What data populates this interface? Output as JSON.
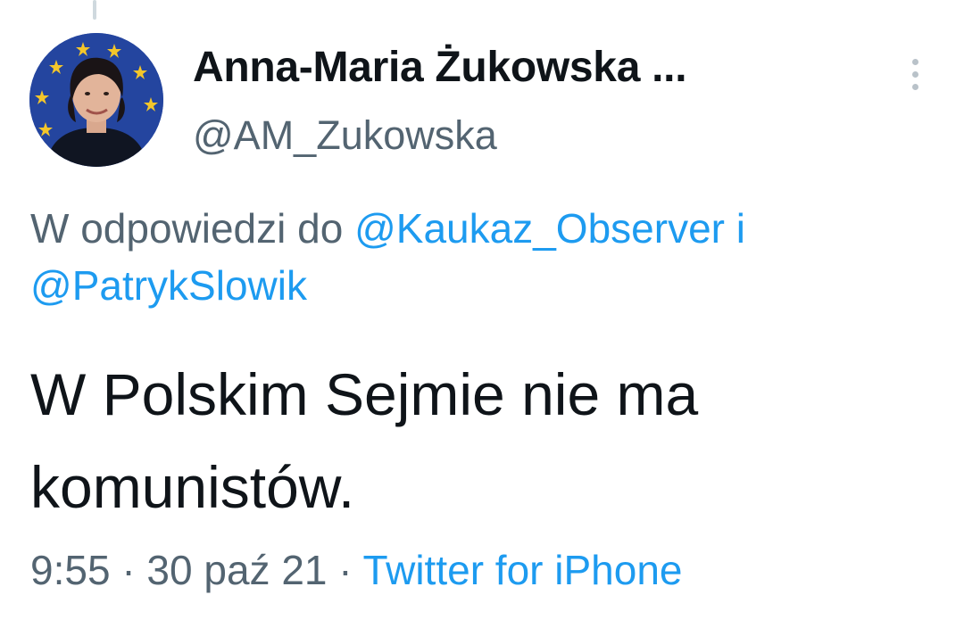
{
  "author": {
    "display_name": "Anna-Maria Żukowska ...",
    "handle": "@AM_Zukowska",
    "avatar_icon": "profile-photo-eu-flag-background"
  },
  "more_icon": "more-vertical-icon",
  "reply_context": {
    "prefix": "W odpowiedzi do",
    "mention_1": "@Kaukaz_Observer",
    "conjunction": "i",
    "mention_2": "@PatrykSlowik"
  },
  "tweet": {
    "text": "W Polskim Sejmie nie ma komunistów."
  },
  "meta": {
    "time": "9:55",
    "separator": "·",
    "date": "30 paź 21",
    "source": "Twitter for iPhone"
  },
  "colors": {
    "link": "#1d9bf0",
    "secondary_text": "#536471",
    "primary_text": "#0f1419",
    "avatar_background": "#1f3f9a"
  }
}
